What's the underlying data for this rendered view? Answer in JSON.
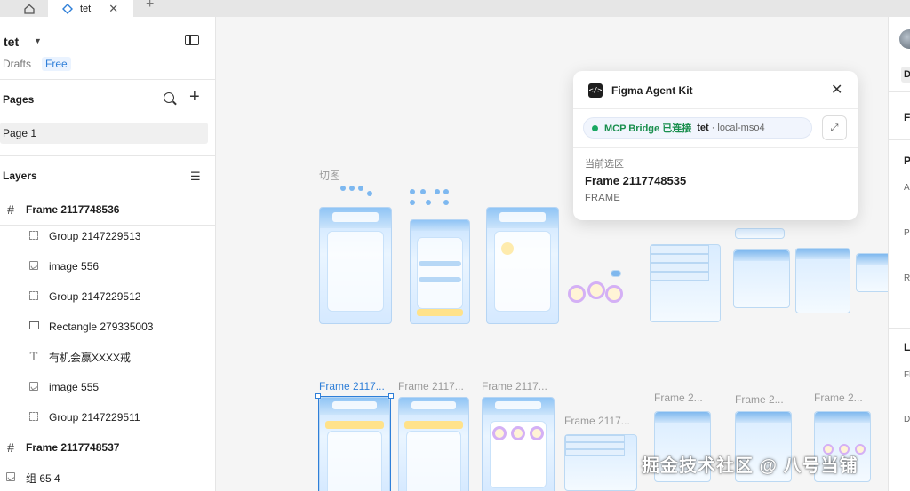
{
  "tabs": {
    "active_label": "tet"
  },
  "file": {
    "name": "tet",
    "location": "Drafts",
    "plan": "Free"
  },
  "pages": {
    "title": "Pages",
    "items": [
      "Page 1"
    ]
  },
  "layers": {
    "title": "Layers",
    "items": [
      {
        "type": "frame",
        "label": "Frame 2117748536"
      },
      {
        "type": "group",
        "label": "Group 2147229513"
      },
      {
        "type": "image",
        "label": "image 556"
      },
      {
        "type": "group",
        "label": "Group 2147229512"
      },
      {
        "type": "rectangle",
        "label": "Rectangle 279335003"
      },
      {
        "type": "text",
        "label": "有机会赢XXXX戒"
      },
      {
        "type": "image",
        "label": "image 555"
      },
      {
        "type": "group",
        "label": "Group 2147229511"
      },
      {
        "type": "frame",
        "label": "Frame 2117748537"
      },
      {
        "type": "group",
        "label": "组 65 4"
      }
    ]
  },
  "canvas": {
    "section_label": "切图",
    "frame_labels": [
      "Frame 2117...",
      "Frame 2117...",
      "Frame 2117...",
      "Frame 2117...",
      "Frame 2...",
      "Frame 2...",
      "Frame 2..."
    ]
  },
  "plugin": {
    "title": "Figma Agent Kit",
    "status": "MCP Bridge 已连接",
    "file_name": "tet",
    "host": "· local-mso4",
    "selection_label": "当前选区",
    "selection_name": "Frame 2117748535",
    "selection_type": "FRAME"
  },
  "right_panel": {
    "letters": [
      "D",
      "F",
      "P",
      "A",
      "P",
      "R",
      "L",
      "Fl",
      "D"
    ]
  },
  "watermark": "掘金技术社区 @ 八号当铺",
  "colors": {
    "accent": "#2f7fd8",
    "connected": "#1aa862"
  }
}
